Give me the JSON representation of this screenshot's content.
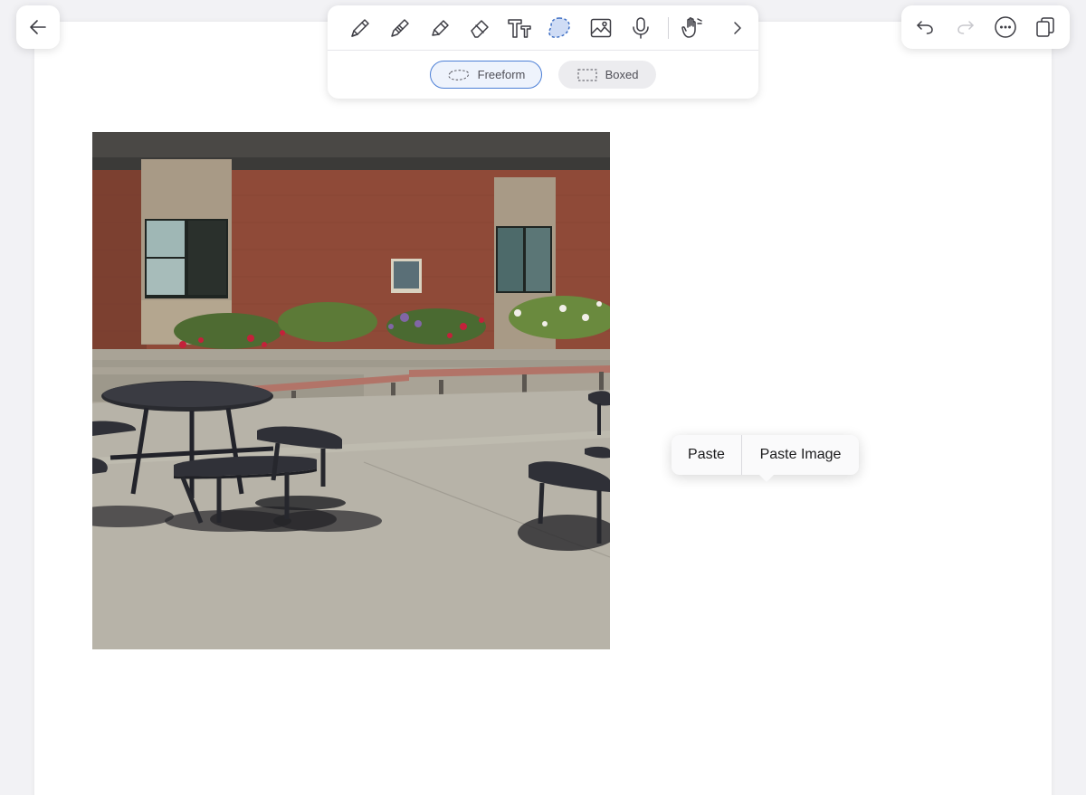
{
  "header": {
    "back_icon": "arrow-left-icon"
  },
  "toolbar": {
    "tools": [
      {
        "id": "pen",
        "icon": "pen-icon"
      },
      {
        "id": "pencil",
        "icon": "pencil-icon"
      },
      {
        "id": "highlighter",
        "icon": "highlighter-icon"
      },
      {
        "id": "eraser",
        "icon": "eraser-icon"
      },
      {
        "id": "text",
        "icon": "text-icon"
      },
      {
        "id": "lasso",
        "icon": "lasso-icon",
        "selected": true
      },
      {
        "id": "image",
        "icon": "image-icon"
      },
      {
        "id": "audio",
        "icon": "microphone-icon"
      },
      {
        "id": "hand",
        "icon": "hand-icon"
      },
      {
        "id": "more",
        "icon": "chevron-right-icon"
      }
    ],
    "modes": {
      "freeform_label": "Freeform",
      "boxed_label": "Boxed",
      "selected": "freeform"
    }
  },
  "rightbar": {
    "buttons": [
      "undo-icon",
      "redo-icon",
      "more-icon",
      "pages-icon"
    ]
  },
  "context_menu": {
    "paste_label": "Paste",
    "paste_image_label": "Paste Image"
  },
  "colors": {
    "accent": "#4c7fd6",
    "lasso_fill": "#cfdcf5",
    "icon": "#3c3c43",
    "disabled": "#c7c7cc"
  }
}
